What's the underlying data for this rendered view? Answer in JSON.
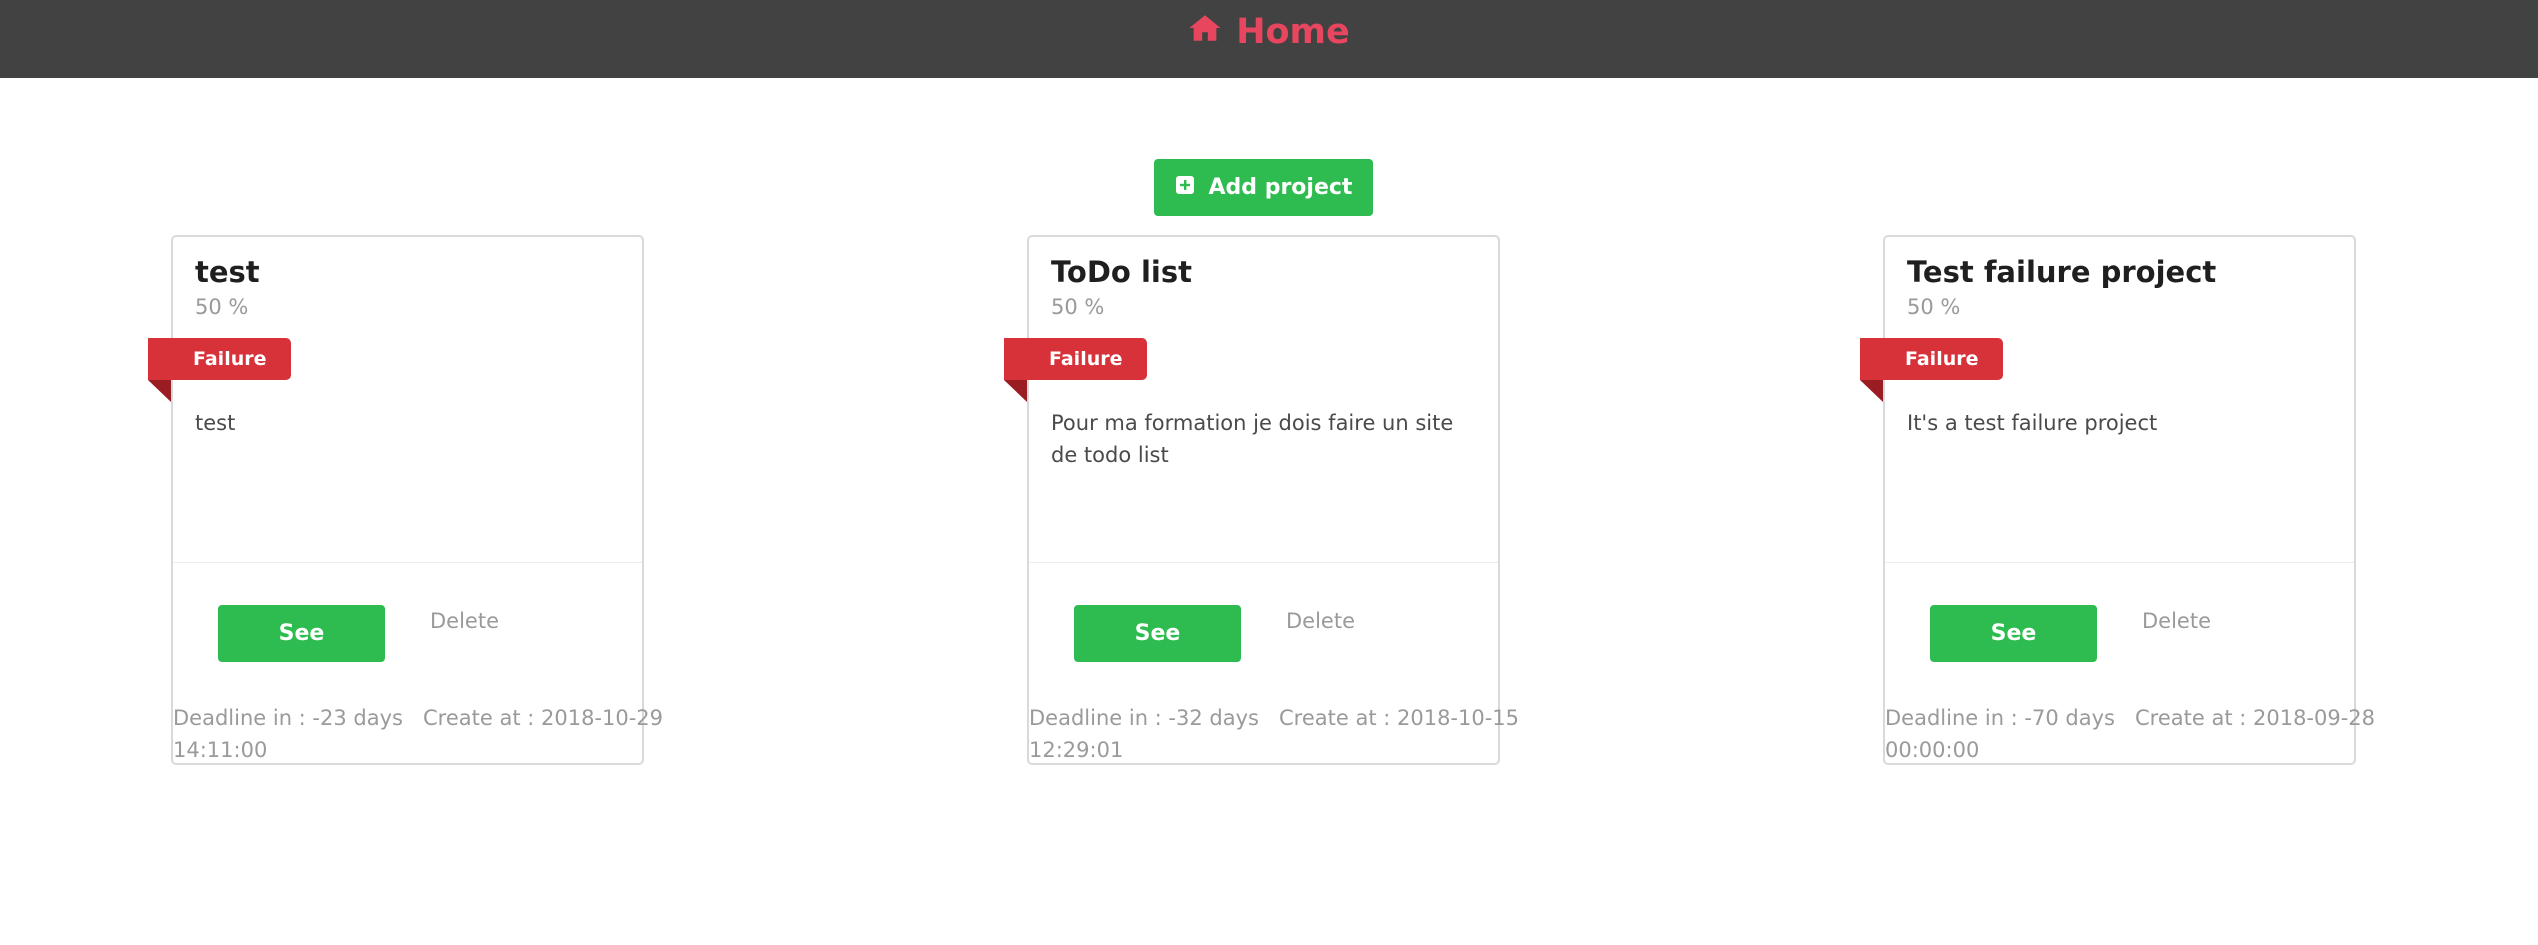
{
  "header": {
    "title": "Home",
    "icon": "home-icon",
    "title_color": "#e8465f",
    "background": "#424242"
  },
  "actions": {
    "add_project_label": "Add project",
    "add_icon": "plus-square-icon",
    "accent": "#2ebb4f"
  },
  "projects": [
    {
      "title": "test",
      "progress": "50 %",
      "status": "Failure",
      "description": "test",
      "see_label": "See",
      "delete_label": "Delete",
      "deadline_line1": "Deadline in : -23 days   Create at : 2018-10-29",
      "deadline_line2": "14:11:00"
    },
    {
      "title": "ToDo list",
      "progress": "50 %",
      "status": "Failure",
      "description": "Pour ma formation je dois faire un site de todo list",
      "see_label": "See",
      "delete_label": "Delete",
      "deadline_line1": "Deadline in : -32 days   Create at : 2018-10-15",
      "deadline_line2": "12:29:01"
    },
    {
      "title": "Test failure project",
      "progress": "50 %",
      "status": "Failure",
      "description": "It's a test failure project",
      "see_label": "See",
      "delete_label": "Delete",
      "deadline_line1": "Deadline in : -70 days   Create at : 2018-09-28",
      "deadline_line2": "00:00:00"
    }
  ],
  "colors": {
    "failure": "#d7323a",
    "muted_text": "#9a9a9a"
  }
}
